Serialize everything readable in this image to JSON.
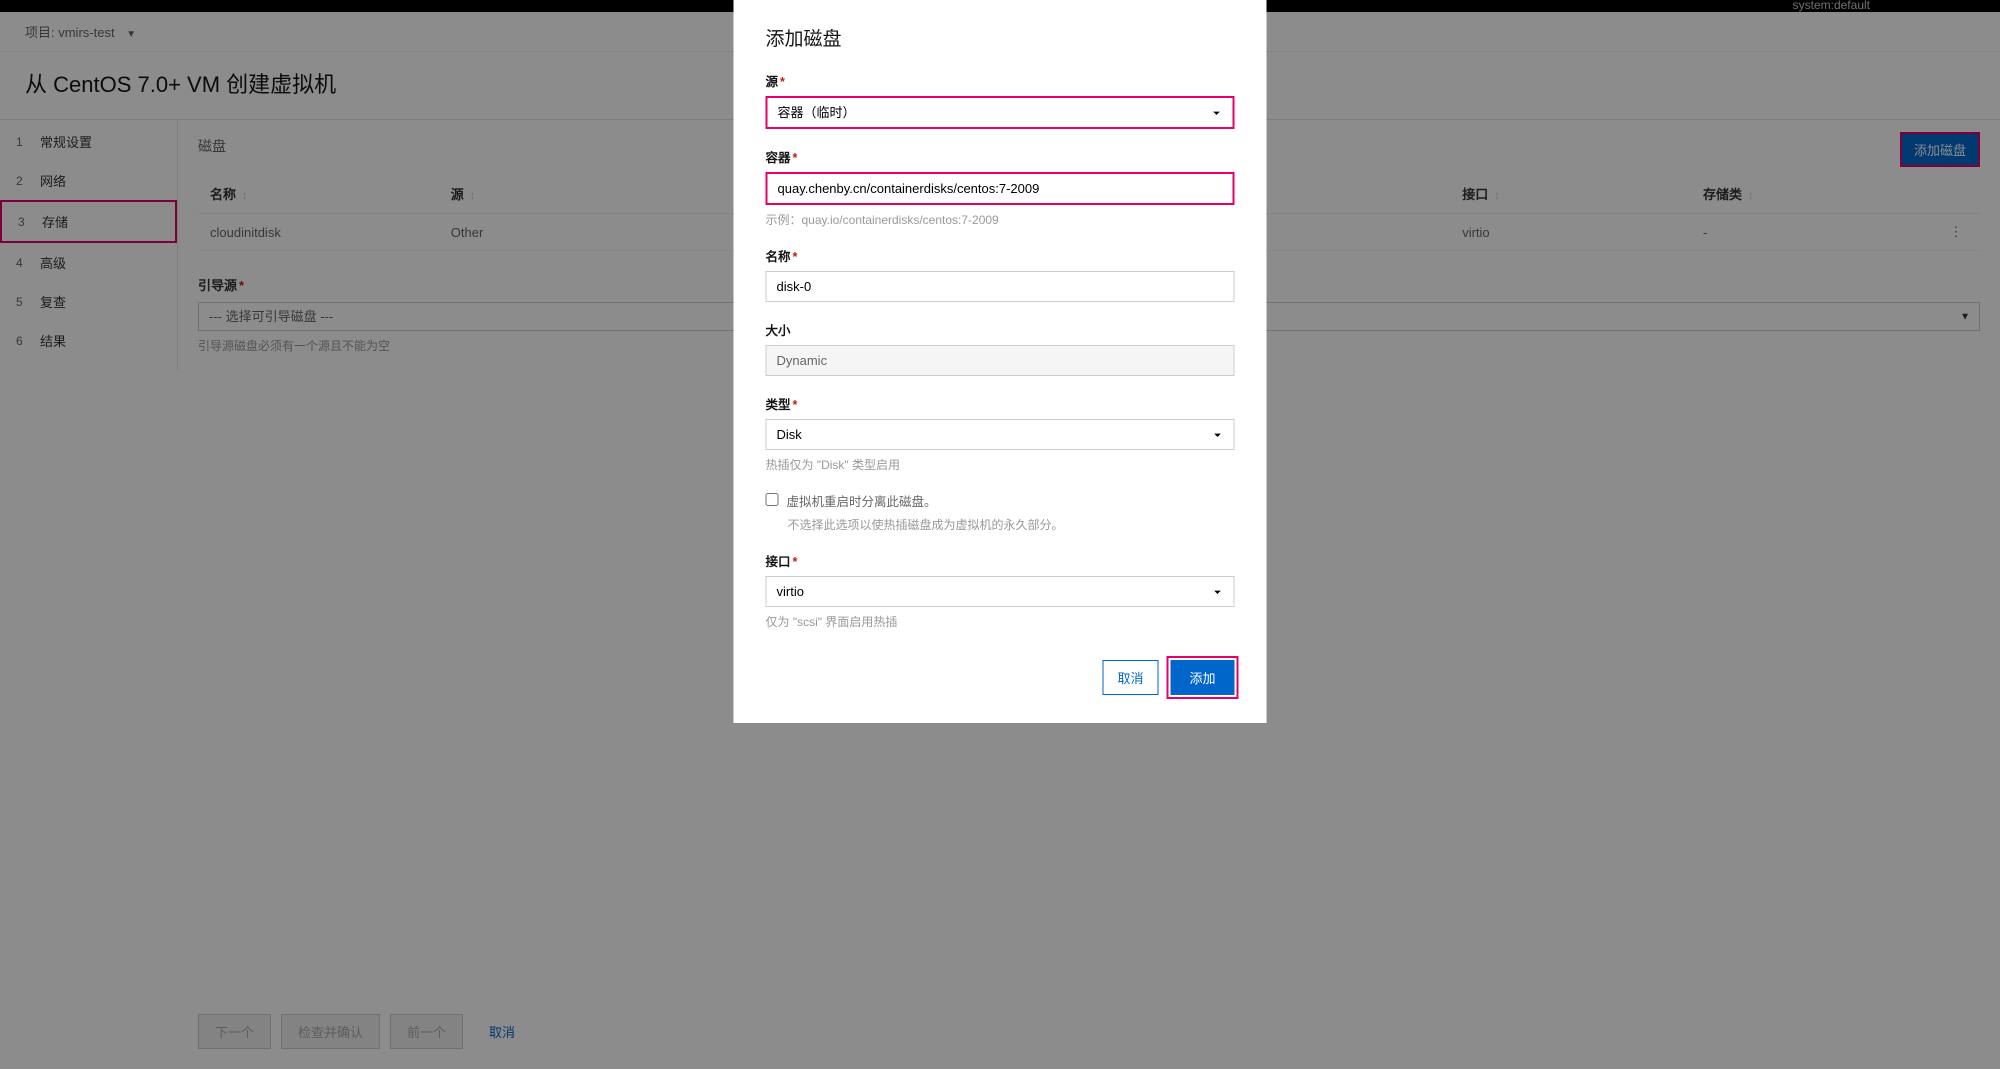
{
  "topbar": {
    "system_text": "system:default"
  },
  "project_bar": {
    "label": "项目: vmirs-test"
  },
  "page_title": "从 CentOS 7.0+ VM 创建虚拟机",
  "sidebar": {
    "items": [
      {
        "num": "1",
        "label": "常规设置"
      },
      {
        "num": "2",
        "label": "网络"
      },
      {
        "num": "3",
        "label": "存储"
      },
      {
        "num": "4",
        "label": "高级"
      },
      {
        "num": "5",
        "label": "复查"
      },
      {
        "num": "6",
        "label": "结果"
      }
    ]
  },
  "main": {
    "section_title": "磁盘",
    "add_disk_button": "添加磁盘",
    "table": {
      "headers": {
        "name": "名称",
        "source": "源",
        "interface": "接口",
        "storage_class": "存储类"
      },
      "rows": [
        {
          "name": "cloudinitdisk",
          "source": "Other",
          "interface": "virtio",
          "storage_class": "-"
        }
      ]
    },
    "boot_source": {
      "label": "引导源",
      "placeholder": "--- 选择可引导磁盘 ---",
      "help": "引导源磁盘必须有一个源且不能为空"
    }
  },
  "footer": {
    "next": "下一个",
    "review": "检查并确认",
    "prev": "前一个",
    "cancel": "取消"
  },
  "modal": {
    "title": "添加磁盘",
    "fields": {
      "source": {
        "label": "源",
        "value": "容器（临时）"
      },
      "container": {
        "label": "容器",
        "value": "quay.chenby.cn/containerdisks/centos:7-2009",
        "help": "示例：quay.io/containerdisks/centos:7-2009"
      },
      "name": {
        "label": "名称",
        "value": "disk-0"
      },
      "size": {
        "label": "大小",
        "value": "Dynamic"
      },
      "type": {
        "label": "类型",
        "value": "Disk",
        "help": "热插仅为 \"Disk\" 类型启用"
      },
      "detach": {
        "label": "虚拟机重启时分离此磁盘。",
        "help": "不选择此选项以使热插磁盘成为虚拟机的永久部分。"
      },
      "interface": {
        "label": "接口",
        "value": "virtio",
        "help": "仅为 \"scsi\" 界面启用热插"
      }
    },
    "buttons": {
      "cancel": "取消",
      "add": "添加"
    }
  }
}
